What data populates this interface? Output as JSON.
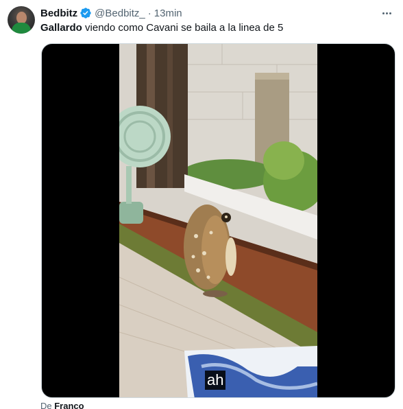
{
  "tweet": {
    "author_name": "Bedbitz",
    "handle": "@Bedbitz_",
    "separator": "·",
    "time": "13min",
    "text_bold": "Gallardo",
    "text_rest": " viendo como Cavani se baila a la linea de 5",
    "verified_color": "#1d9bf0"
  },
  "media": {
    "subtitle": "ah"
  },
  "credit": {
    "prefix": "De ",
    "name": "Franco"
  },
  "icons": {
    "avatar": "profile-photo",
    "verified": "verified-badge-icon",
    "more": "more-horizontal-icon"
  }
}
